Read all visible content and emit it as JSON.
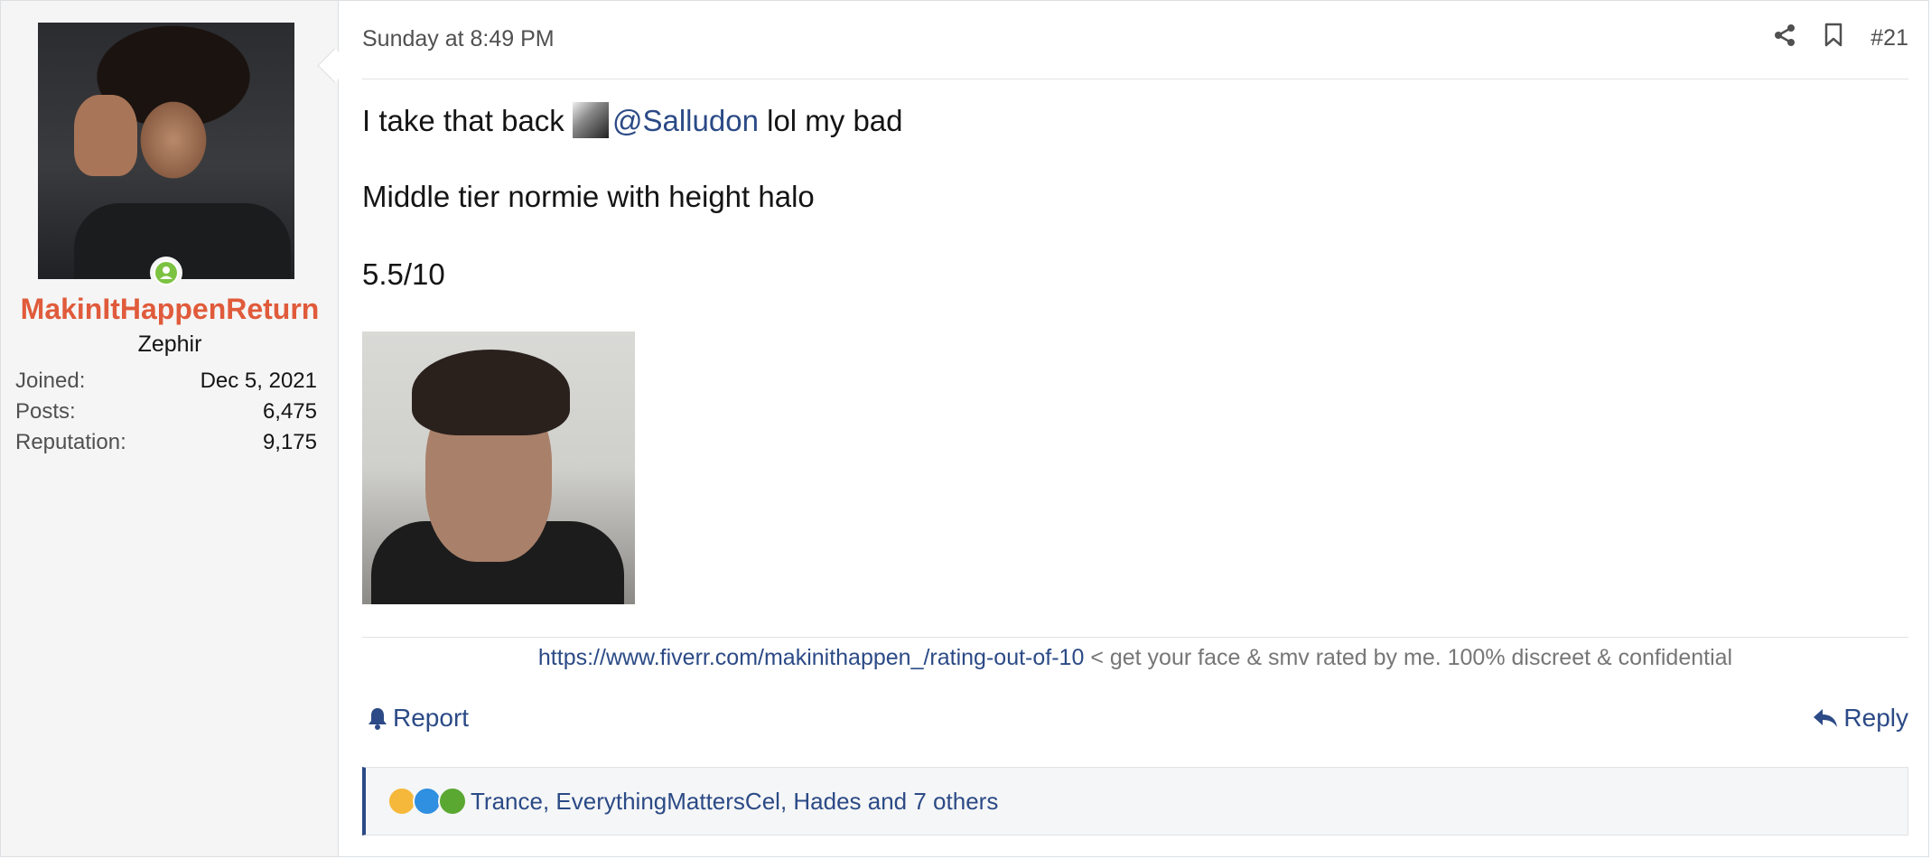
{
  "user": {
    "username": "MakinItHappenReturn",
    "title": "Zephir",
    "stats": [
      {
        "label": "Joined:",
        "value": "Dec 5, 2021"
      },
      {
        "label": "Posts:",
        "value": "6,475"
      },
      {
        "label": "Reputation:",
        "value": "9,175"
      }
    ]
  },
  "post": {
    "date": "Sunday at 8:49 PM",
    "number": "#21",
    "lines": {
      "line1_prefix": "I take that back",
      "mention": "@Salludon",
      "line1_suffix": "lol my bad",
      "line2": "Middle tier normie with height halo",
      "line3": "5.5/10"
    },
    "signature": {
      "link": "https://www.fiverr.com/makinithappen_/rating-out-of-10",
      "text": "< get your face & smv rated by me. 100% discreet & confidential"
    },
    "report_label": "Report",
    "reply_label": "Reply",
    "reactions_text": "Trance, EverythingMattersCel, Hades and 7 others"
  },
  "colors": {
    "username": "#e05b3b",
    "link": "#2b4a86",
    "online": "#7cc242"
  },
  "icons": [
    "online-icon",
    "share-icon",
    "bookmark-icon",
    "bell-icon",
    "reply-icon",
    "reaction-icons"
  ]
}
